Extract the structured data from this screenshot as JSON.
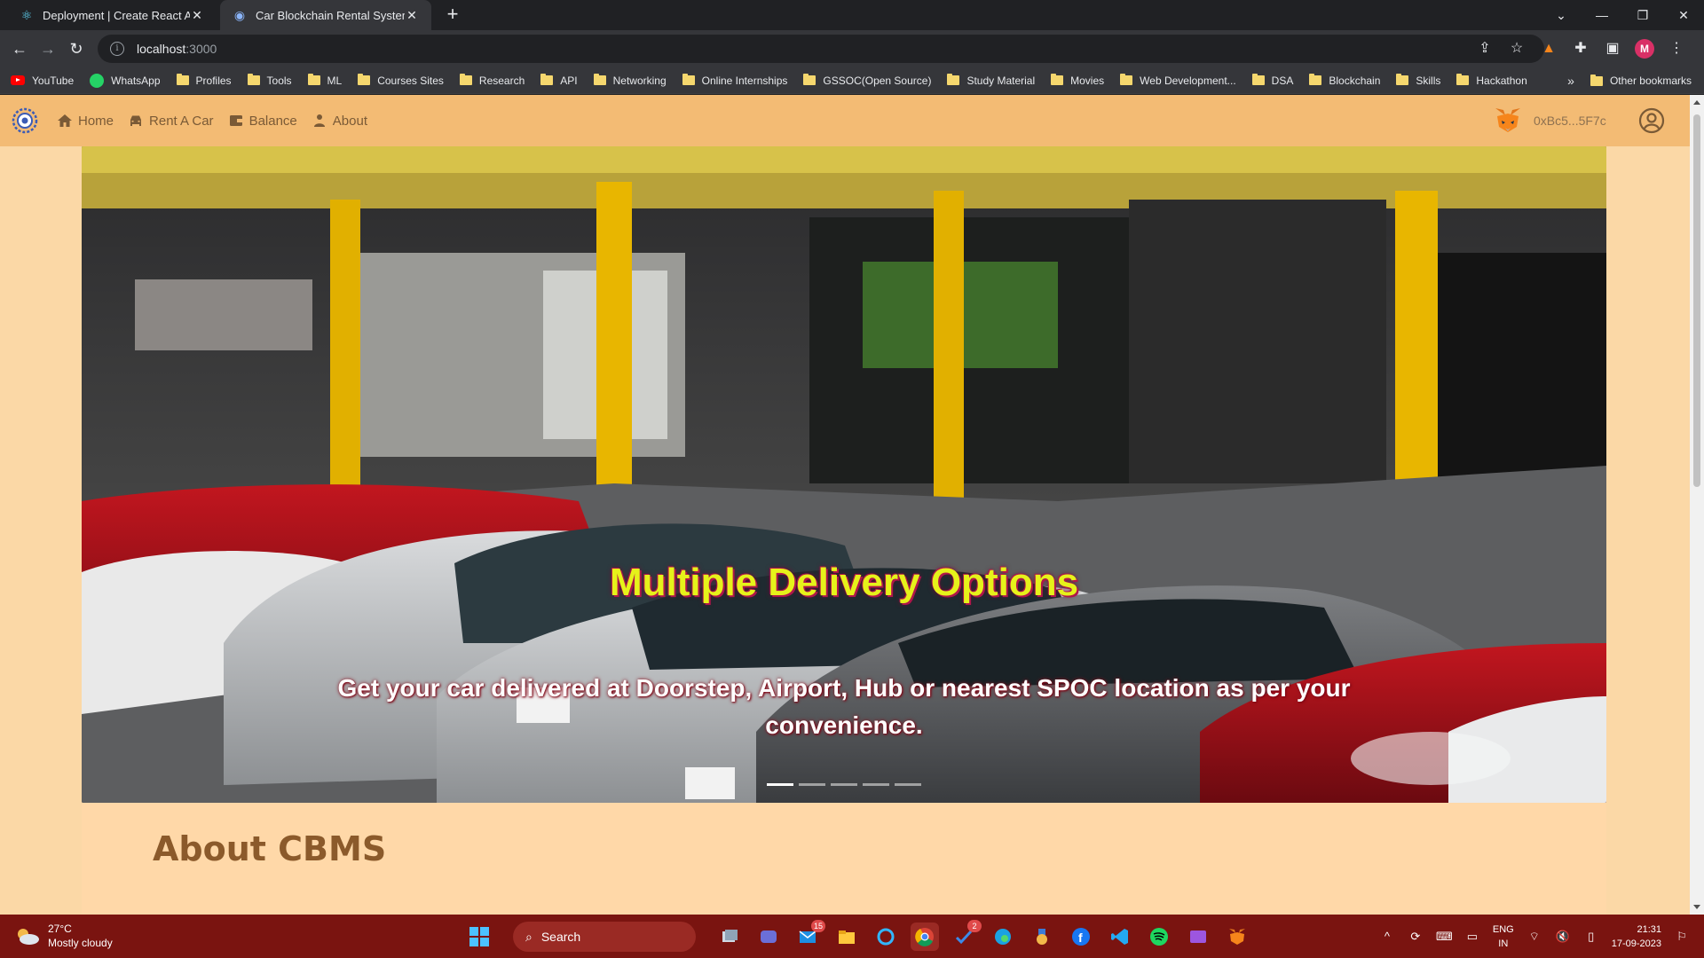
{
  "browser": {
    "tabs": [
      {
        "title": "Deployment | Create React App",
        "active": false
      },
      {
        "title": "Car Blockchain Rental System",
        "active": true
      }
    ],
    "address": {
      "host": "localhost",
      "port": ":3000"
    },
    "bookmarks": [
      {
        "label": "YouTube",
        "icon": "youtube-icon"
      },
      {
        "label": "WhatsApp",
        "icon": "whatsapp-icon"
      },
      {
        "label": "Profiles",
        "icon": "folder-icon"
      },
      {
        "label": "Tools",
        "icon": "folder-icon"
      },
      {
        "label": "ML",
        "icon": "folder-icon"
      },
      {
        "label": "Courses Sites",
        "icon": "folder-icon"
      },
      {
        "label": "Research",
        "icon": "folder-icon"
      },
      {
        "label": "API",
        "icon": "folder-icon"
      },
      {
        "label": "Networking",
        "icon": "folder-icon"
      },
      {
        "label": "Online Internships",
        "icon": "folder-icon"
      },
      {
        "label": "GSSOC(Open Source)",
        "icon": "folder-icon"
      },
      {
        "label": "Study Material",
        "icon": "folder-icon"
      },
      {
        "label": "Movies",
        "icon": "folder-icon"
      },
      {
        "label": "Web Development...",
        "icon": "folder-icon"
      },
      {
        "label": "DSA",
        "icon": "folder-icon"
      },
      {
        "label": "Blockchain",
        "icon": "folder-icon"
      },
      {
        "label": "Skills",
        "icon": "folder-icon"
      },
      {
        "label": "Hackathon",
        "icon": "folder-icon"
      }
    ],
    "other_bookmarks": "Other bookmarks",
    "profile_initial": "M"
  },
  "app": {
    "nav": {
      "home": "Home",
      "rent": "Rent A Car",
      "balance": "Balance",
      "about": "About"
    },
    "wallet_address": "0xBc5...5F7c",
    "carousel": {
      "title": "Multiple Delivery Options",
      "text": "Get your car delivered at Doorstep, Airport, Hub or nearest SPOC location as per your convenience.",
      "slide_count": 5,
      "active_index": 0
    },
    "about_heading": "About CBMS"
  },
  "taskbar": {
    "weather": {
      "temp": "27°C",
      "condition": "Mostly cloudy"
    },
    "search_label": "Search",
    "mail_badge": "15",
    "todo_badge": "2",
    "lang": {
      "line1": "ENG",
      "line2": "IN"
    },
    "time": "21:31",
    "date": "17-09-2023"
  },
  "colors": {
    "nav_bg": "#f3bb74",
    "page_bg": "#fbd8a6",
    "caption_title": "#e6f21a",
    "about_heading": "#8b5a2b",
    "taskbar_bg": "#7a1410"
  }
}
